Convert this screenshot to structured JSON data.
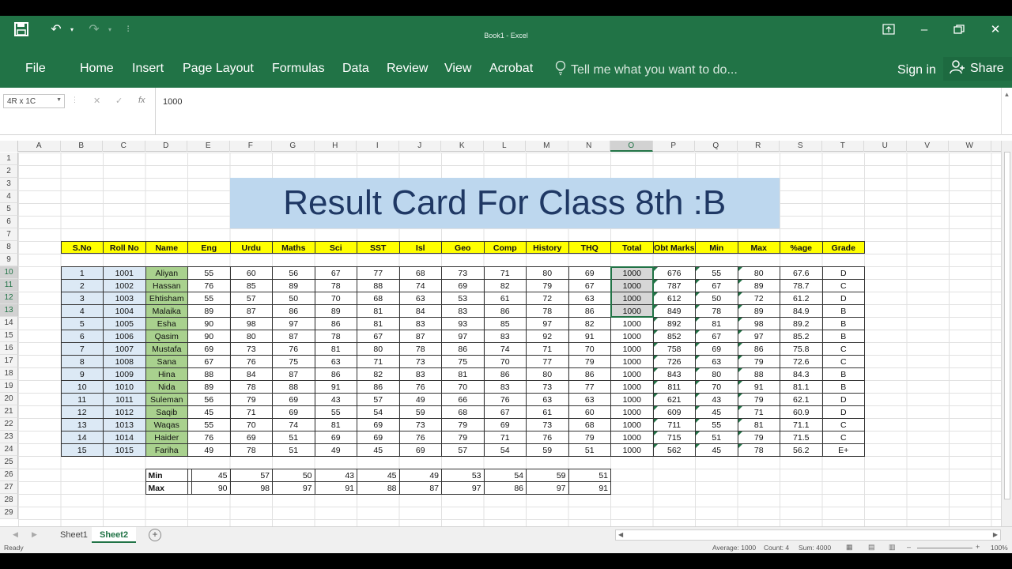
{
  "window": {
    "title": "Book1 - Excel"
  },
  "ribbon": {
    "tabs": [
      "File",
      "Home",
      "Insert",
      "Page Layout",
      "Formulas",
      "Data",
      "Review",
      "View",
      "Acrobat"
    ],
    "tell_me": "Tell me what you want to do...",
    "sign_in": "Sign in",
    "share": "Share"
  },
  "formula_bar": {
    "name_box": "4R x 1C",
    "value": "1000"
  },
  "columns": [
    "A",
    "B",
    "C",
    "D",
    "E",
    "F",
    "G",
    "H",
    "I",
    "J",
    "K",
    "L",
    "M",
    "N",
    "O",
    "P",
    "Q",
    "R",
    "S",
    "T",
    "U",
    "V",
    "W"
  ],
  "selected_column": "O",
  "rows": [
    "1",
    "2",
    "3",
    "4",
    "5",
    "6",
    "7",
    "8",
    "9",
    "10",
    "11",
    "12",
    "13",
    "14",
    "15",
    "16",
    "17",
    "18",
    "19",
    "20",
    "21",
    "22",
    "23",
    "24",
    "25",
    "26",
    "27",
    "28",
    "29"
  ],
  "banner": "Result Card For Class 8th :B",
  "table": {
    "headers": [
      "S.No",
      "Roll No",
      "Name",
      "Eng",
      "Urdu",
      "Maths",
      "Sci",
      "SST",
      "Isl",
      "Geo",
      "Comp",
      "History",
      "THQ",
      "Total",
      "Obt Marks",
      "Min",
      "Max",
      "%age",
      "Grade"
    ],
    "rows": [
      [
        "1",
        "1001",
        "Aliyan",
        "55",
        "60",
        "56",
        "67",
        "77",
        "68",
        "73",
        "71",
        "80",
        "69",
        "1000",
        "676",
        "55",
        "80",
        "67.6",
        "D"
      ],
      [
        "2",
        "1002",
        "Hassan",
        "76",
        "85",
        "89",
        "78",
        "88",
        "74",
        "69",
        "82",
        "79",
        "67",
        "1000",
        "787",
        "67",
        "89",
        "78.7",
        "C"
      ],
      [
        "3",
        "1003",
        "Ehtisham",
        "55",
        "57",
        "50",
        "70",
        "68",
        "63",
        "53",
        "61",
        "72",
        "63",
        "1000",
        "612",
        "50",
        "72",
        "61.2",
        "D"
      ],
      [
        "4",
        "1004",
        "Malaika",
        "89",
        "87",
        "86",
        "89",
        "81",
        "84",
        "83",
        "86",
        "78",
        "86",
        "1000",
        "849",
        "78",
        "89",
        "84.9",
        "B"
      ],
      [
        "5",
        "1005",
        "Esha",
        "90",
        "98",
        "97",
        "86",
        "81",
        "83",
        "93",
        "85",
        "97",
        "82",
        "1000",
        "892",
        "81",
        "98",
        "89.2",
        "B"
      ],
      [
        "6",
        "1006",
        "Qasim",
        "90",
        "80",
        "87",
        "78",
        "67",
        "87",
        "97",
        "83",
        "92",
        "91",
        "1000",
        "852",
        "67",
        "97",
        "85.2",
        "B"
      ],
      [
        "7",
        "1007",
        "Mustafa",
        "69",
        "73",
        "76",
        "81",
        "80",
        "78",
        "86",
        "74",
        "71",
        "70",
        "1000",
        "758",
        "69",
        "86",
        "75.8",
        "C"
      ],
      [
        "8",
        "1008",
        "Sana",
        "67",
        "76",
        "75",
        "63",
        "71",
        "73",
        "75",
        "70",
        "77",
        "79",
        "1000",
        "726",
        "63",
        "79",
        "72.6",
        "C"
      ],
      [
        "9",
        "1009",
        "Hina",
        "88",
        "84",
        "87",
        "86",
        "82",
        "83",
        "81",
        "86",
        "80",
        "86",
        "1000",
        "843",
        "80",
        "88",
        "84.3",
        "B"
      ],
      [
        "10",
        "1010",
        "Nida",
        "89",
        "78",
        "88",
        "91",
        "86",
        "76",
        "70",
        "83",
        "73",
        "77",
        "1000",
        "811",
        "70",
        "91",
        "81.1",
        "B"
      ],
      [
        "11",
        "1011",
        "Suleman",
        "56",
        "79",
        "69",
        "43",
        "57",
        "49",
        "66",
        "76",
        "63",
        "63",
        "1000",
        "621",
        "43",
        "79",
        "62.1",
        "D"
      ],
      [
        "12",
        "1012",
        "Saqib",
        "45",
        "71",
        "69",
        "55",
        "54",
        "59",
        "68",
        "67",
        "61",
        "60",
        "1000",
        "609",
        "45",
        "71",
        "60.9",
        "D"
      ],
      [
        "13",
        "1013",
        "Waqas",
        "55",
        "70",
        "74",
        "81",
        "69",
        "73",
        "79",
        "69",
        "73",
        "68",
        "1000",
        "711",
        "55",
        "81",
        "71.1",
        "C"
      ],
      [
        "14",
        "1014",
        "Haider",
        "76",
        "69",
        "51",
        "69",
        "69",
        "76",
        "79",
        "71",
        "76",
        "79",
        "1000",
        "715",
        "51",
        "79",
        "71.5",
        "C"
      ],
      [
        "15",
        "1015",
        "Fariha",
        "49",
        "78",
        "51",
        "49",
        "45",
        "69",
        "57",
        "54",
        "59",
        "51",
        "1000",
        "562",
        "45",
        "78",
        "56.2",
        "E+"
      ]
    ]
  },
  "summary": {
    "rows": [
      {
        "label": "Min",
        "values": [
          "45",
          "57",
          "50",
          "43",
          "45",
          "49",
          "53",
          "54",
          "59",
          "51"
        ]
      },
      {
        "label": "Max",
        "values": [
          "90",
          "98",
          "97",
          "91",
          "88",
          "87",
          "97",
          "86",
          "97",
          "91"
        ]
      }
    ]
  },
  "sheets": {
    "tabs": [
      "Sheet1",
      "Sheet2"
    ],
    "active": "Sheet2"
  },
  "status": {
    "ready": "Ready",
    "average": "Average: 1000",
    "count": "Count: 4",
    "sum": "Sum: 4000",
    "zoom": "100%"
  },
  "colors": {
    "excel_green": "#217346",
    "header_yellow": "#ffff00",
    "sno_blue": "#dce9f5",
    "name_green": "#a9d18e",
    "banner_blue": "#bdd7ee"
  }
}
